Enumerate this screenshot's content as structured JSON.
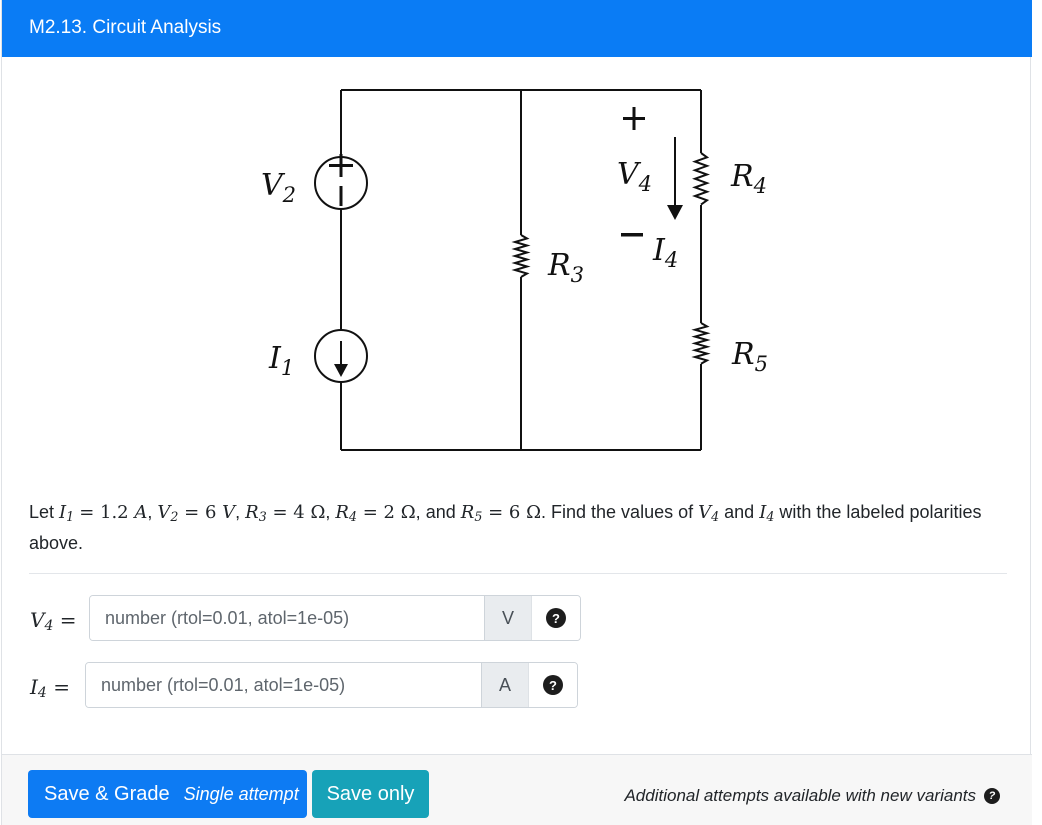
{
  "header": {
    "title": "M2.13. Circuit Analysis"
  },
  "diagram": {
    "source_v_label": "V",
    "source_v_sub": "2",
    "source_i_label": "I",
    "source_i_sub": "1",
    "r3_label": "R",
    "r3_sub": "3",
    "r4_label": "R",
    "r4_sub": "4",
    "r5_label": "R",
    "r5_sub": "5",
    "v4_label": "V",
    "v4_sub": "4",
    "i4_label": "I",
    "i4_sub": "4",
    "plus": "+",
    "minus": "−"
  },
  "problem": {
    "let": "Let",
    "i1_sym": "I",
    "i1_sub": "1",
    "i1_val": "= 1.2",
    "i1_unit": "A",
    "v2_sym": "V",
    "v2_sub": "2",
    "v2_val": "= 6",
    "v2_unit": "V",
    "r3_sym": "R",
    "r3_sub": "3",
    "r3_val": "= 4",
    "r3_unit": "Ω",
    "r4_sym": "R",
    "r4_sub": "4",
    "r4_val": "= 2",
    "r4_unit": "Ω",
    "and": "and",
    "r5_sym": "R",
    "r5_sub": "5",
    "r5_val": "= 6",
    "r5_unit": "Ω",
    "find": "Find the values of",
    "v4_sym": "V",
    "v4_sub": "4",
    "and2": "and",
    "i4_sym": "I",
    "i4_sub": "4",
    "tail": "with the labeled polarities above."
  },
  "answers": [
    {
      "sym": "V",
      "sub": "4",
      "eq": "=",
      "placeholder": "number (rtol=0.01, atol=1e-05)",
      "value": "",
      "unit": "V",
      "help": "?"
    },
    {
      "sym": "I",
      "sub": "4",
      "eq": "=",
      "placeholder": "number (rtol=0.01, atol=1e-05)",
      "value": "",
      "unit": "A",
      "help": "?"
    }
  ],
  "footer": {
    "save_grade": "Save & Grade",
    "attempt": "Single attempt",
    "save_only": "Save only",
    "note": "Additional attempts available with new variants",
    "note_help": "?"
  },
  "colors": {
    "header": "#0a7cf5",
    "primary": "#0d7bf3",
    "info": "#17a2b8"
  }
}
